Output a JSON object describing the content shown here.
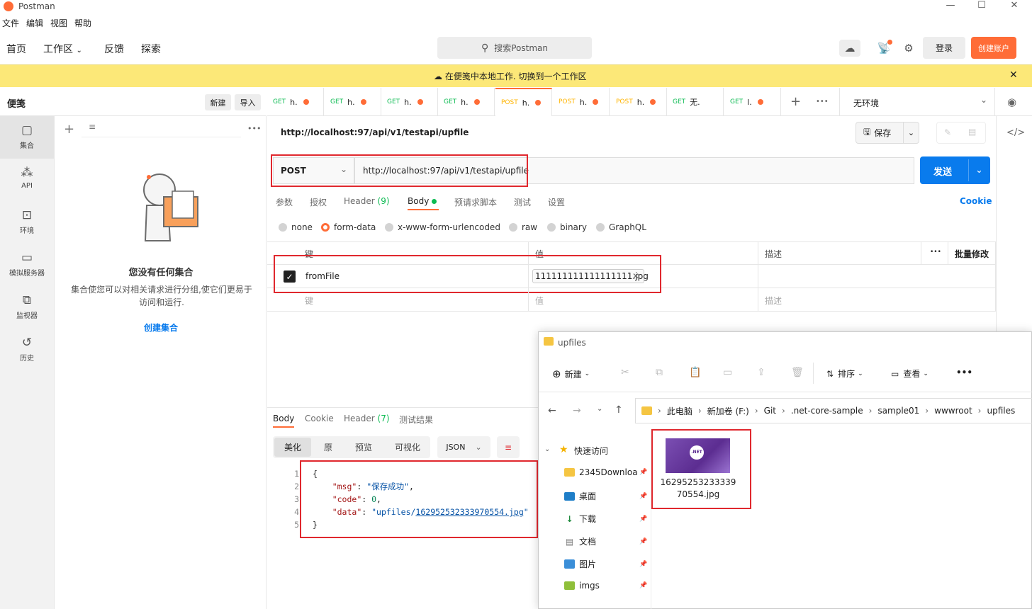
{
  "app": {
    "title": "Postman"
  },
  "menu": [
    "文件",
    "编辑",
    "视图",
    "帮助"
  ],
  "nav": {
    "home": "首页",
    "workspace": "工作区",
    "feedback": "反馈",
    "explore": "探索",
    "search_placeholder": "搜索Postman",
    "login": "登录",
    "signup": "创建账户"
  },
  "banner": {
    "text": "在便笺中本地工作.",
    "link": "切换到一个工作区"
  },
  "sidebar": {
    "title": "便笺",
    "new": "新建",
    "import": "导入",
    "items": [
      {
        "label": "集合",
        "icon": "collection-icon"
      },
      {
        "label": "API",
        "icon": "api-icon"
      },
      {
        "label": "环境",
        "icon": "environment-icon"
      },
      {
        "label": "模拟服务器",
        "icon": "mock-server-icon"
      },
      {
        "label": "监视器",
        "icon": "monitor-icon"
      },
      {
        "label": "历史",
        "icon": "history-icon"
      }
    ],
    "empty_title": "您没有任何集合",
    "empty_desc": "集合使您可以对相关请求进行分组,使它们更易于访问和运行.",
    "create": "创建集合"
  },
  "tabs": [
    {
      "method": "GET",
      "name": "h."
    },
    {
      "method": "GET",
      "name": "h."
    },
    {
      "method": "GET",
      "name": "h."
    },
    {
      "method": "GET",
      "name": "h."
    },
    {
      "method": "POST",
      "name": "h."
    },
    {
      "method": "POST",
      "name": "h."
    },
    {
      "method": "POST",
      "name": "h."
    },
    {
      "method": "GET",
      "name": "无."
    },
    {
      "method": "GET",
      "name": "l."
    }
  ],
  "env": {
    "label": "无环境"
  },
  "request": {
    "path": "http://localhost:97/api/v1/testapi/upfile",
    "method": "POST",
    "url": "http://localhost:97/api/v1/testapi/upfile",
    "send": "发送",
    "save": "保存",
    "subtabs": [
      "参数",
      "授权",
      "Header",
      "Body",
      "预请求脚本",
      "测试",
      "设置"
    ],
    "header_count": "(9)",
    "cookie": "Cookie",
    "body_types": [
      "none",
      "form-data",
      "x-www-form-urlencoded",
      "raw",
      "binary",
      "GraphQL"
    ],
    "selected_body": "form-data",
    "table": {
      "col_key": "键",
      "col_value": "值",
      "col_desc": "描述",
      "bulk": "批量修改",
      "row_key": "fromFile",
      "row_value": "111111111111111111.jpg",
      "ph_key": "键",
      "ph_value": "值",
      "ph_desc": "描述"
    }
  },
  "response": {
    "tabs": [
      "Body",
      "Cookie",
      "Header",
      "测试结果"
    ],
    "header_count": "(7)",
    "views": [
      "美化",
      "原",
      "预览",
      "可视化"
    ],
    "format": "JSON",
    "lines": [
      "{",
      "    \"msg\": \"保存成功\",",
      "    \"code\": 0,",
      "    \"data\": \"upfiles/162952532333970554.jpg\"",
      "}"
    ],
    "msg_key": "\"msg\"",
    "msg_val": "\"保存成功\"",
    "code_key": "\"code\"",
    "code_val": "0",
    "data_key": "\"data\"",
    "data_prefix": "\"upfiles/",
    "data_link": "162952532333970554.jpg",
    "data_suffix": "\""
  },
  "explorer": {
    "title": "upfiles",
    "new": "新建",
    "sort": "排序",
    "view": "查看",
    "breadcrumb": [
      "此电脑",
      "新加卷 (F:)",
      "Git",
      ".net-core-sample",
      "sample01",
      "wwwroot",
      "upfiles"
    ],
    "quick": "快速访问",
    "tree": [
      "2345Downloa",
      "桌面",
      "下载",
      "文档",
      "图片",
      "imgs"
    ],
    "file": {
      "name_line1": "16295253233339",
      "name_line2": "70554.jpg",
      "thumb_label": ".NET"
    }
  }
}
